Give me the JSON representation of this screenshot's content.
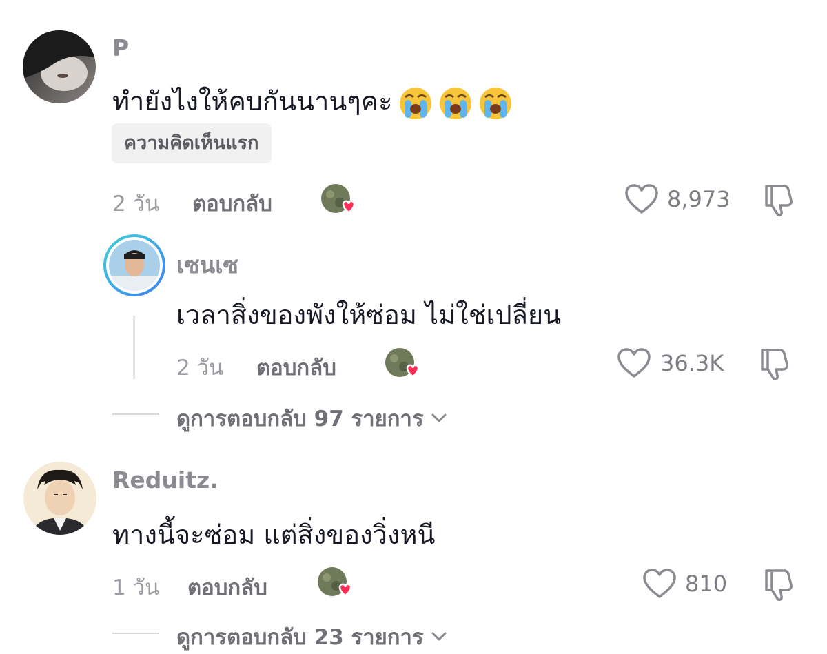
{
  "comments": [
    {
      "username": "P",
      "text": "ทำยังไงให้คบกันนานๆคะ",
      "emojis": [
        "loudly-crying-face",
        "loudly-crying-face",
        "loudly-crying-face"
      ],
      "badge": "ความคิดเห็นแรก",
      "time": "2 วัน",
      "reply_label": "ตอบกลับ",
      "likes": "8,973",
      "replies": [
        {
          "username": "เซนเซ",
          "text": "เวลาสิ่งของพังให้ซ่อม ไม่ใช่เปลี่ยน",
          "time": "2 วัน",
          "reply_label": "ตอบกลับ",
          "likes": "36.3K"
        }
      ],
      "view_replies": "ดูการตอบกลับ 97 รายการ"
    },
    {
      "username": "Reduitz.",
      "text": "ทางนี้จะซ่อม แต่สิ่งของวิ่งหนี",
      "time": "1 วัน",
      "reply_label": "ตอบกลับ",
      "likes": "810",
      "view_replies": "ดูการตอบกลับ 23 รายการ"
    }
  ],
  "colors": {
    "heart_badge": "#fe2c55",
    "text_primary": "#161823",
    "text_secondary": "#8a8b91",
    "story_ring_start": "#3fd3d9",
    "story_ring_end": "#3b7ef0"
  },
  "icons": {
    "like": "heart-outline-icon",
    "dislike": "thumbs-down-outline-icon",
    "expand": "chevron-down-icon",
    "creator_liked": "creator-liked-heart-icon"
  }
}
